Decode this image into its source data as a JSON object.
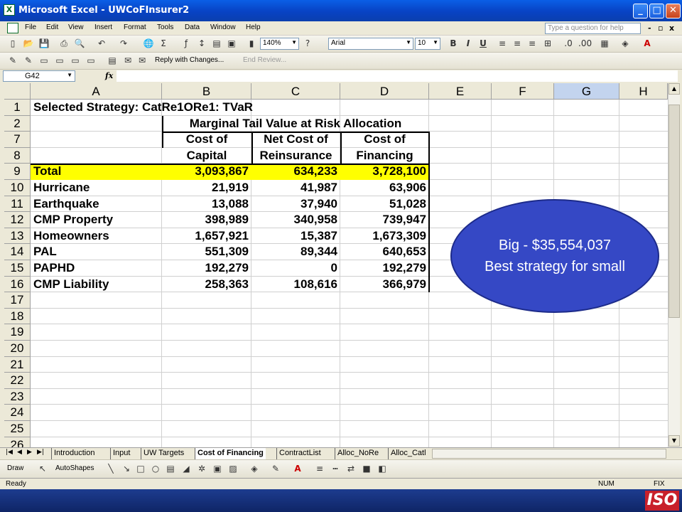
{
  "window": {
    "title": "Microsoft Excel - UWCoFInsurer2"
  },
  "menu": [
    "File",
    "Edit",
    "View",
    "Insert",
    "Format",
    "Tools",
    "Data",
    "Window",
    "Help"
  ],
  "help_box_placeholder": "Type a question for help",
  "toolbar": {
    "zoom": "140%",
    "font_name": "Arial",
    "font_size": "10",
    "bold_label": "B",
    "italic_label": "I",
    "underline_label": "U",
    "reply_changes": "Reply with Changes...",
    "end_review": "End Review..."
  },
  "formula_bar": {
    "name_box": "G42",
    "fx": "fx",
    "value": ""
  },
  "columns": [
    "A",
    "B",
    "C",
    "D",
    "E",
    "F",
    "G",
    "H"
  ],
  "active_column": "G",
  "row_numbers": [
    "1",
    "2",
    "7",
    "8",
    "9",
    "10",
    "11",
    "12",
    "13",
    "14",
    "15",
    "16",
    "17",
    "18",
    "19",
    "20",
    "21",
    "22",
    "23",
    "24",
    "25",
    "26"
  ],
  "sheet": {
    "a1": "Selected Strategy: CatRe1ORe1: TVaR",
    "title_row2": "Marginal Tail Value at Risk Allocation",
    "headers_row7": [
      "Cost of",
      "Net Cost of",
      "Cost of"
    ],
    "headers_row8": [
      "Capital",
      "Reinsurance",
      "Financing"
    ],
    "rows": [
      {
        "label": "Total",
        "b": "3,093,867",
        "c": "634,233",
        "d": "3,728,100"
      },
      {
        "label": "Hurricane",
        "b": "21,919",
        "c": "41,987",
        "d": "63,906"
      },
      {
        "label": "Earthquake",
        "b": "13,088",
        "c": "37,940",
        "d": "51,028"
      },
      {
        "label": "CMP Property",
        "b": "398,989",
        "c": "340,958",
        "d": "739,947"
      },
      {
        "label": "Homeowners",
        "b": "1,657,921",
        "c": "15,387",
        "d": "1,673,309"
      },
      {
        "label": "PAL",
        "b": "551,309",
        "c": "89,344",
        "d": "640,653"
      },
      {
        "label": "PAPHD",
        "b": "192,279",
        "c": "0",
        "d": "192,279"
      },
      {
        "label": "CMP Liability",
        "b": "258,363",
        "c": "108,616",
        "d": "366,979"
      }
    ]
  },
  "callout": {
    "line1": "Big - $35,554,037",
    "line2": "Best strategy for small"
  },
  "sheet_tabs": [
    "Introduction",
    "Input",
    "UW Targets",
    "Cost of Financing",
    "ContractList",
    "Alloc_NoRe",
    "Alloc_Catl"
  ],
  "active_tab": "Cost of Financing",
  "drawing_toolbar": {
    "draw": "Draw",
    "autoshapes": "AutoShapes"
  },
  "status": {
    "ready": "Ready",
    "num": "NUM",
    "fix": "FIX"
  },
  "logo_text": "ISO"
}
